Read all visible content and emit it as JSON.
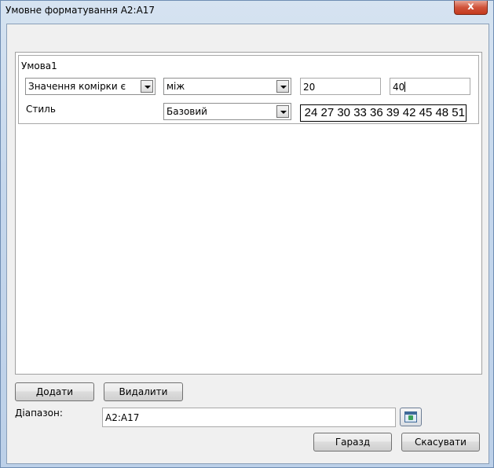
{
  "window": {
    "title": "Умовне форматування A2:A17",
    "close_glyph": "x"
  },
  "condition": {
    "label": "Умова1",
    "type_value": "Значення комірки є",
    "operator_value": "між",
    "value1": "20",
    "value2": "40",
    "style_label": "Стиль",
    "style_value": "Базовий",
    "preview_text": "24 27 30 33 36 39 42 45 48 51"
  },
  "buttons": {
    "add": "Додати",
    "delete": "Видалити",
    "ok": "Гаразд",
    "cancel": "Скасувати"
  },
  "range": {
    "label": "Діапазон:",
    "value": "A2:A17"
  },
  "icons": {
    "dropdown": "chevron-down-icon",
    "range_select": "shrink-dialog-icon"
  }
}
